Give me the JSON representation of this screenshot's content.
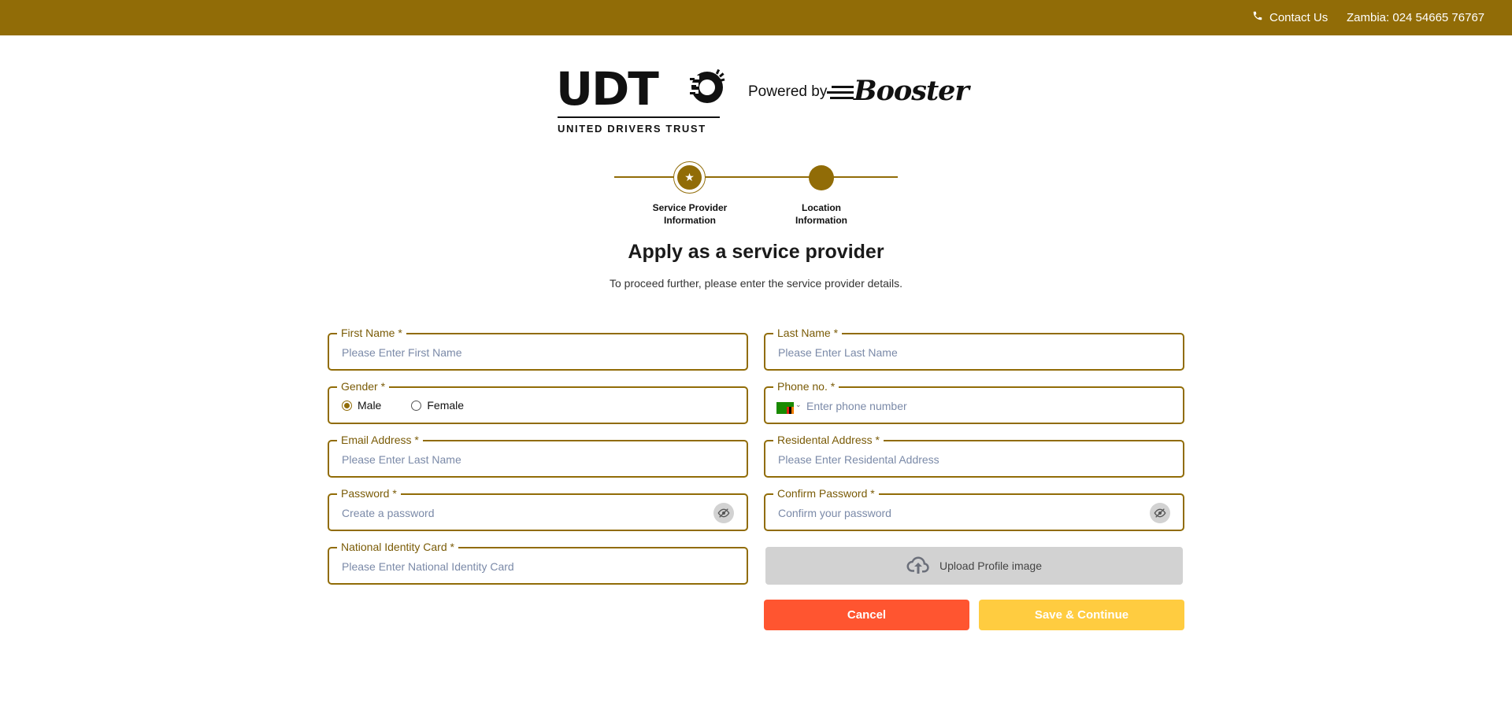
{
  "topbar": {
    "contact_label": "Contact Us",
    "phone_line": "Zambia: 024 54665 76767",
    "icon": "phone-icon"
  },
  "branding": {
    "logo_text": "UDT",
    "logo_subtitle": "UNITED DRIVERS TRUST",
    "powered_by": "Powered by",
    "partner_name": "Booster"
  },
  "stepper": {
    "steps": [
      {
        "label_line1": "Service Provider",
        "label_line2": "Information",
        "active": true
      },
      {
        "label_line1": "Location",
        "label_line2": "Information",
        "active": false
      }
    ]
  },
  "page": {
    "title": "Apply as a service provider",
    "subtitle": "To proceed further, please enter the service provider details."
  },
  "form": {
    "first_name": {
      "label": "First Name *",
      "placeholder": "Please Enter First Name",
      "value": ""
    },
    "last_name": {
      "label": "Last Name *",
      "placeholder": "Please Enter Last Name",
      "value": ""
    },
    "gender": {
      "label": "Gender *",
      "options": [
        "Male",
        "Female"
      ],
      "selected": "Male"
    },
    "phone": {
      "label": "Phone no. *",
      "placeholder": "Enter phone number",
      "value": ""
    },
    "email": {
      "label": "Email Address *",
      "placeholder": "Please Enter Last Name",
      "value": ""
    },
    "address": {
      "label": "Residental Address *",
      "placeholder": "Please Enter Residental Address",
      "value": ""
    },
    "password": {
      "label": "Password *",
      "placeholder": "Create a password",
      "value": ""
    },
    "confirm_password": {
      "label": "Confirm Password *",
      "placeholder": "Confirm your password",
      "value": ""
    },
    "nic": {
      "label": "National Identity Card *",
      "placeholder": "Please Enter National Identity Card",
      "value": ""
    },
    "upload_label": "Upload Profile image",
    "cancel_label": "Cancel",
    "save_label": "Save & Continue"
  },
  "colors": {
    "brand": "#916c07",
    "cancel": "#ff5530",
    "save": "#ffcc40",
    "upload_bg": "#d2d2d2"
  }
}
